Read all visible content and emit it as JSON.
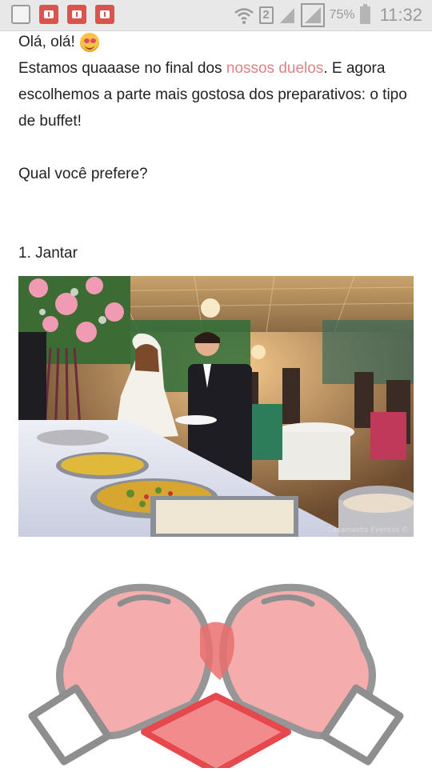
{
  "statusbar": {
    "sim_slot": "2",
    "battery_percent": "75%",
    "clock": "11:32",
    "icons": [
      "gallery-icon",
      "notification-icon",
      "notification-icon",
      "notification-icon",
      "wifi-icon",
      "sim-icon",
      "signal-icon",
      "signal-icon",
      "battery-icon"
    ],
    "colors": {
      "notification": "#d9534f",
      "bar": "#e8e8e8"
    }
  },
  "article": {
    "greeting": "Olá, olá!",
    "intro_before_link": "Estamos quaaase no final dos ",
    "link_text": "nossos duelos",
    "intro_after_link": ". E agora escolhemos a parte mais gostosa dos preparativos: o tipo de buffet!",
    "question": "Qual você prefere?",
    "option_1": "1. Jantar",
    "photo_watermark": "Casamento Eventos ©"
  },
  "colors": {
    "link": "#e08283",
    "text": "#222222",
    "glove": "#f4a6a6"
  }
}
